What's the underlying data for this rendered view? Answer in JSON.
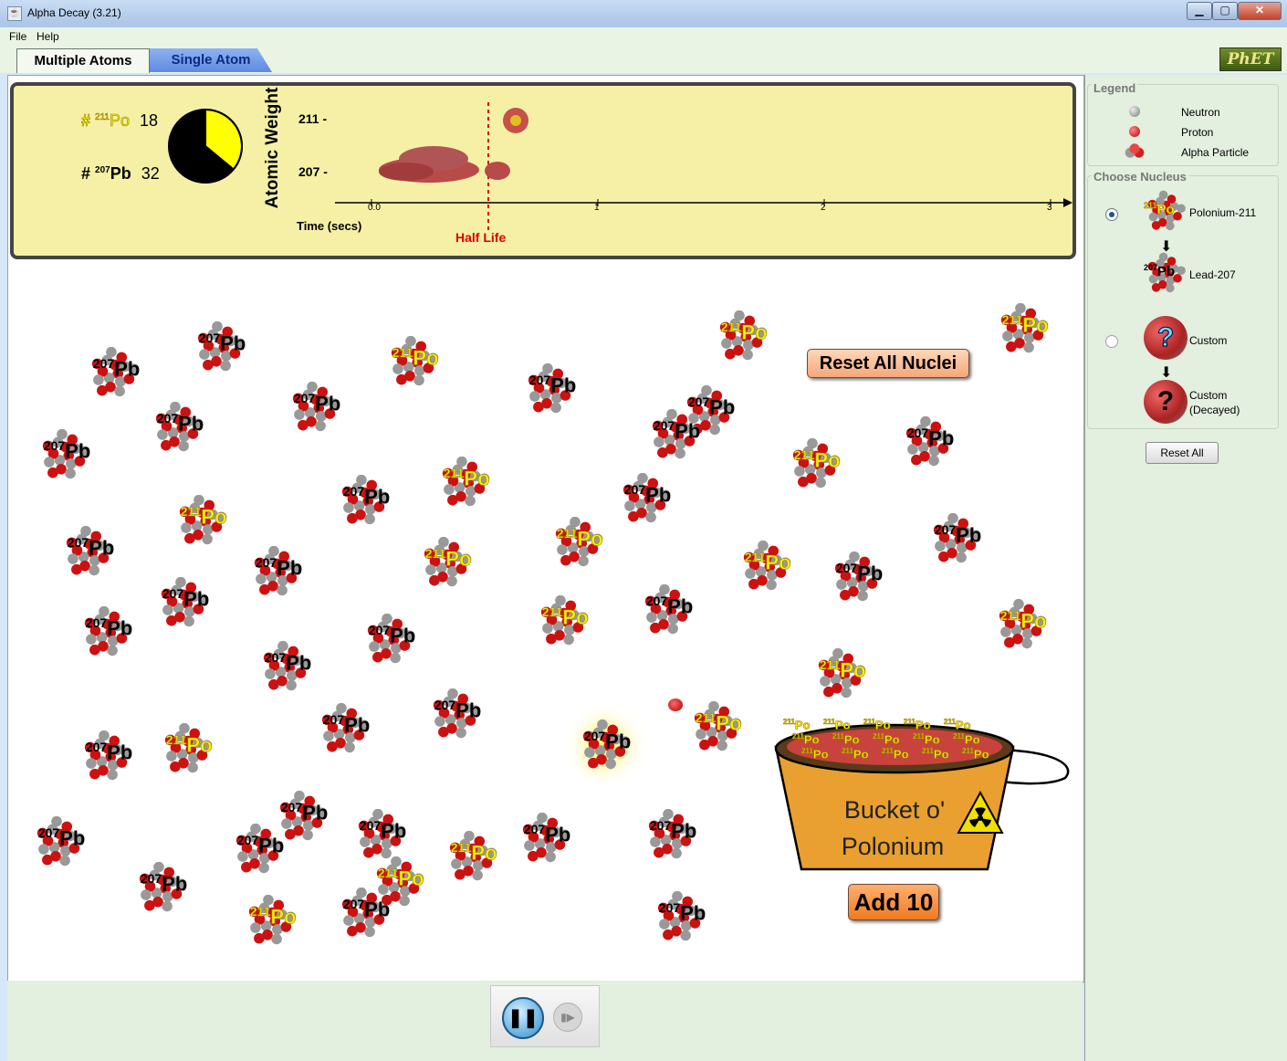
{
  "window": {
    "title": "Alpha Decay (3.21)"
  },
  "menu": {
    "file": "File",
    "help": "Help"
  },
  "tabs": [
    {
      "label": "Multiple Atoms"
    },
    {
      "label": "Single Atom"
    }
  ],
  "logo": "PhET",
  "stats": {
    "po_label_prefix": "#",
    "po_mass": "211",
    "po_symbol": "Po",
    "po_count": "18",
    "pb_label_prefix": "#",
    "pb_mass": "207",
    "pb_symbol": "Pb",
    "pb_count": "32",
    "pie_fraction_po": 0.36
  },
  "chart": {
    "y_title": "Atomic Weight",
    "y_ticks": [
      "211 -",
      "207 -"
    ],
    "x_title": "Time (secs)",
    "x_ticks": [
      "0.0",
      "1",
      "2",
      "3"
    ],
    "half_life_label": "Half Life"
  },
  "canvas": {
    "reset_all_nuclei": "Reset All Nuclei",
    "bucket_line1": "Bucket o'",
    "bucket_line2": "Polonium",
    "add_10": "Add 10"
  },
  "nucleus_labels": {
    "po_mass": "211",
    "po_symbol": "Po",
    "pb_mass": "207",
    "pb_symbol": "Pb"
  },
  "legend": {
    "title": "Legend",
    "items": [
      {
        "label": "Neutron"
      },
      {
        "label": "Proton"
      },
      {
        "label": "Alpha Particle"
      }
    ]
  },
  "choose_nucleus": {
    "title": "Choose Nucleus",
    "polonium": "Polonium-211",
    "lead": "Lead-207",
    "custom": "Custom",
    "custom_decayed_1": "Custom",
    "custom_decayed_2": "(Decayed)",
    "selected": "Polonium-211"
  },
  "reset_all": "Reset All",
  "colors": {
    "proton": "#cc1111",
    "neutron": "#999999",
    "chart_bg": "#f5f0a6",
    "po_label": "#f7f200",
    "half_life": "#dd0000"
  }
}
